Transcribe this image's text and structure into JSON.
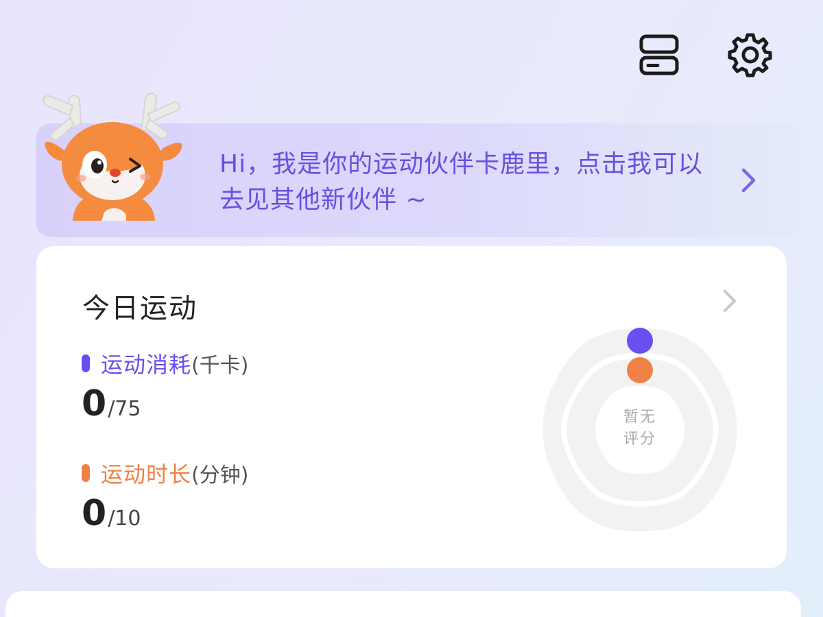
{
  "header": {
    "storage_icon": "storage-icon",
    "settings_icon": "gear-icon"
  },
  "companion": {
    "message": "Hi，我是你的运动伙伴卡鹿里，点击我可以去见其他新伙伴 ~",
    "mascot": "deer-mascot",
    "accent_color": "#6a4fe0"
  },
  "today": {
    "title": "今日运动",
    "metrics": [
      {
        "name": "运动消耗",
        "unit": "(千卡)",
        "current": "0",
        "target": "/75",
        "color": "#6b4ef0"
      },
      {
        "name": "运动时长",
        "unit": "(分钟)",
        "current": "0",
        "target": "/10",
        "color": "#f08146"
      }
    ],
    "score": {
      "line1": "暂无",
      "line2": "评分"
    }
  }
}
